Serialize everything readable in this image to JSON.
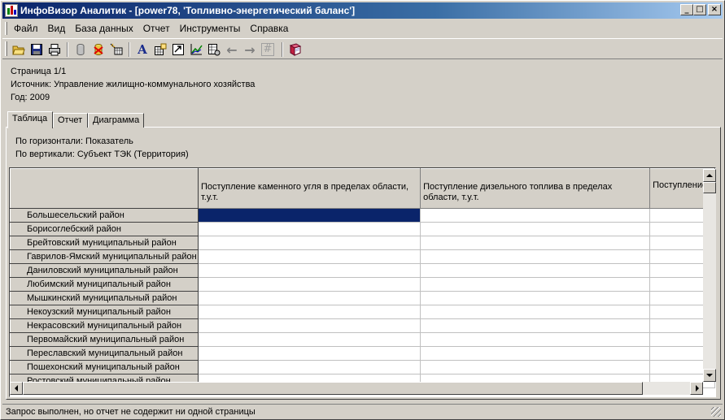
{
  "window": {
    "title": "ИнфоВизор Аналитик - [power78, 'Топливно-энергетический баланс']",
    "buttons": [
      "_",
      "□",
      "×"
    ]
  },
  "menu": [
    "Файл",
    "Вид",
    "База данных",
    "Отчет",
    "Инструменты",
    "Справка"
  ],
  "toolbar": {
    "buttons": [
      {
        "icon": "open-folder-icon"
      },
      {
        "icon": "save-icon"
      },
      {
        "icon": "print-icon"
      },
      {
        "icon": "database-icon"
      },
      {
        "icon": "database-delete-icon"
      },
      {
        "icon": "database-wizard-icon"
      },
      {
        "icon": "font-icon",
        "glyph": "A"
      },
      {
        "icon": "table-properties-icon"
      },
      {
        "icon": "export-icon"
      },
      {
        "icon": "chart-icon"
      },
      {
        "icon": "table-settings-icon"
      },
      {
        "icon": "back-arrow-icon",
        "glyph": "←",
        "disabled": true
      },
      {
        "icon": "forward-arrow-icon",
        "glyph": "→",
        "disabled": true
      },
      {
        "icon": "page-number-icon",
        "glyph": "#",
        "disabled": true
      },
      {
        "icon": "help-book-icon"
      }
    ]
  },
  "report_info": {
    "page": "Страница 1/1",
    "source": "Источник: Управление жилищно-коммунального хозяйства",
    "year": "Год: 2009"
  },
  "tabs": [
    "Таблица",
    "Отчет",
    "Диаграмма"
  ],
  "active_tab": "Таблица",
  "axes": {
    "horizontal": "По горизонтали: Показатель",
    "vertical": "По вертикали: Субъект ТЭК (Территория)"
  },
  "table": {
    "columns": [
      "Поступление каменного угля в пределах области, т.у.т.",
      "Поступление дизельного топлива в пределах области, т.у.т.",
      "Поступление"
    ],
    "rows": [
      "Большесельский район",
      "Борисоглебский район",
      "Брейтовский муниципальный район",
      "Гаврилов-Ямский муниципальный район",
      "Даниловский муниципальный район",
      "Любимский муниципальный район",
      "Мышкинский муниципальный район",
      "Некоузский муниципальный район",
      "Некрасовский муниципальный район",
      "Первомайский муниципальный район",
      "Переславский муниципальный район",
      "Пошехонский муниципальный район",
      "Ростовский муниципальный район"
    ]
  },
  "status": "Запрос выполнен, но отчет не содержит ни одной страницы",
  "colors": {
    "title_gradient_start": "#0a246a",
    "title_gradient_end": "#a6caf0",
    "selection": "#0a246a",
    "face": "#d4d0c8"
  }
}
